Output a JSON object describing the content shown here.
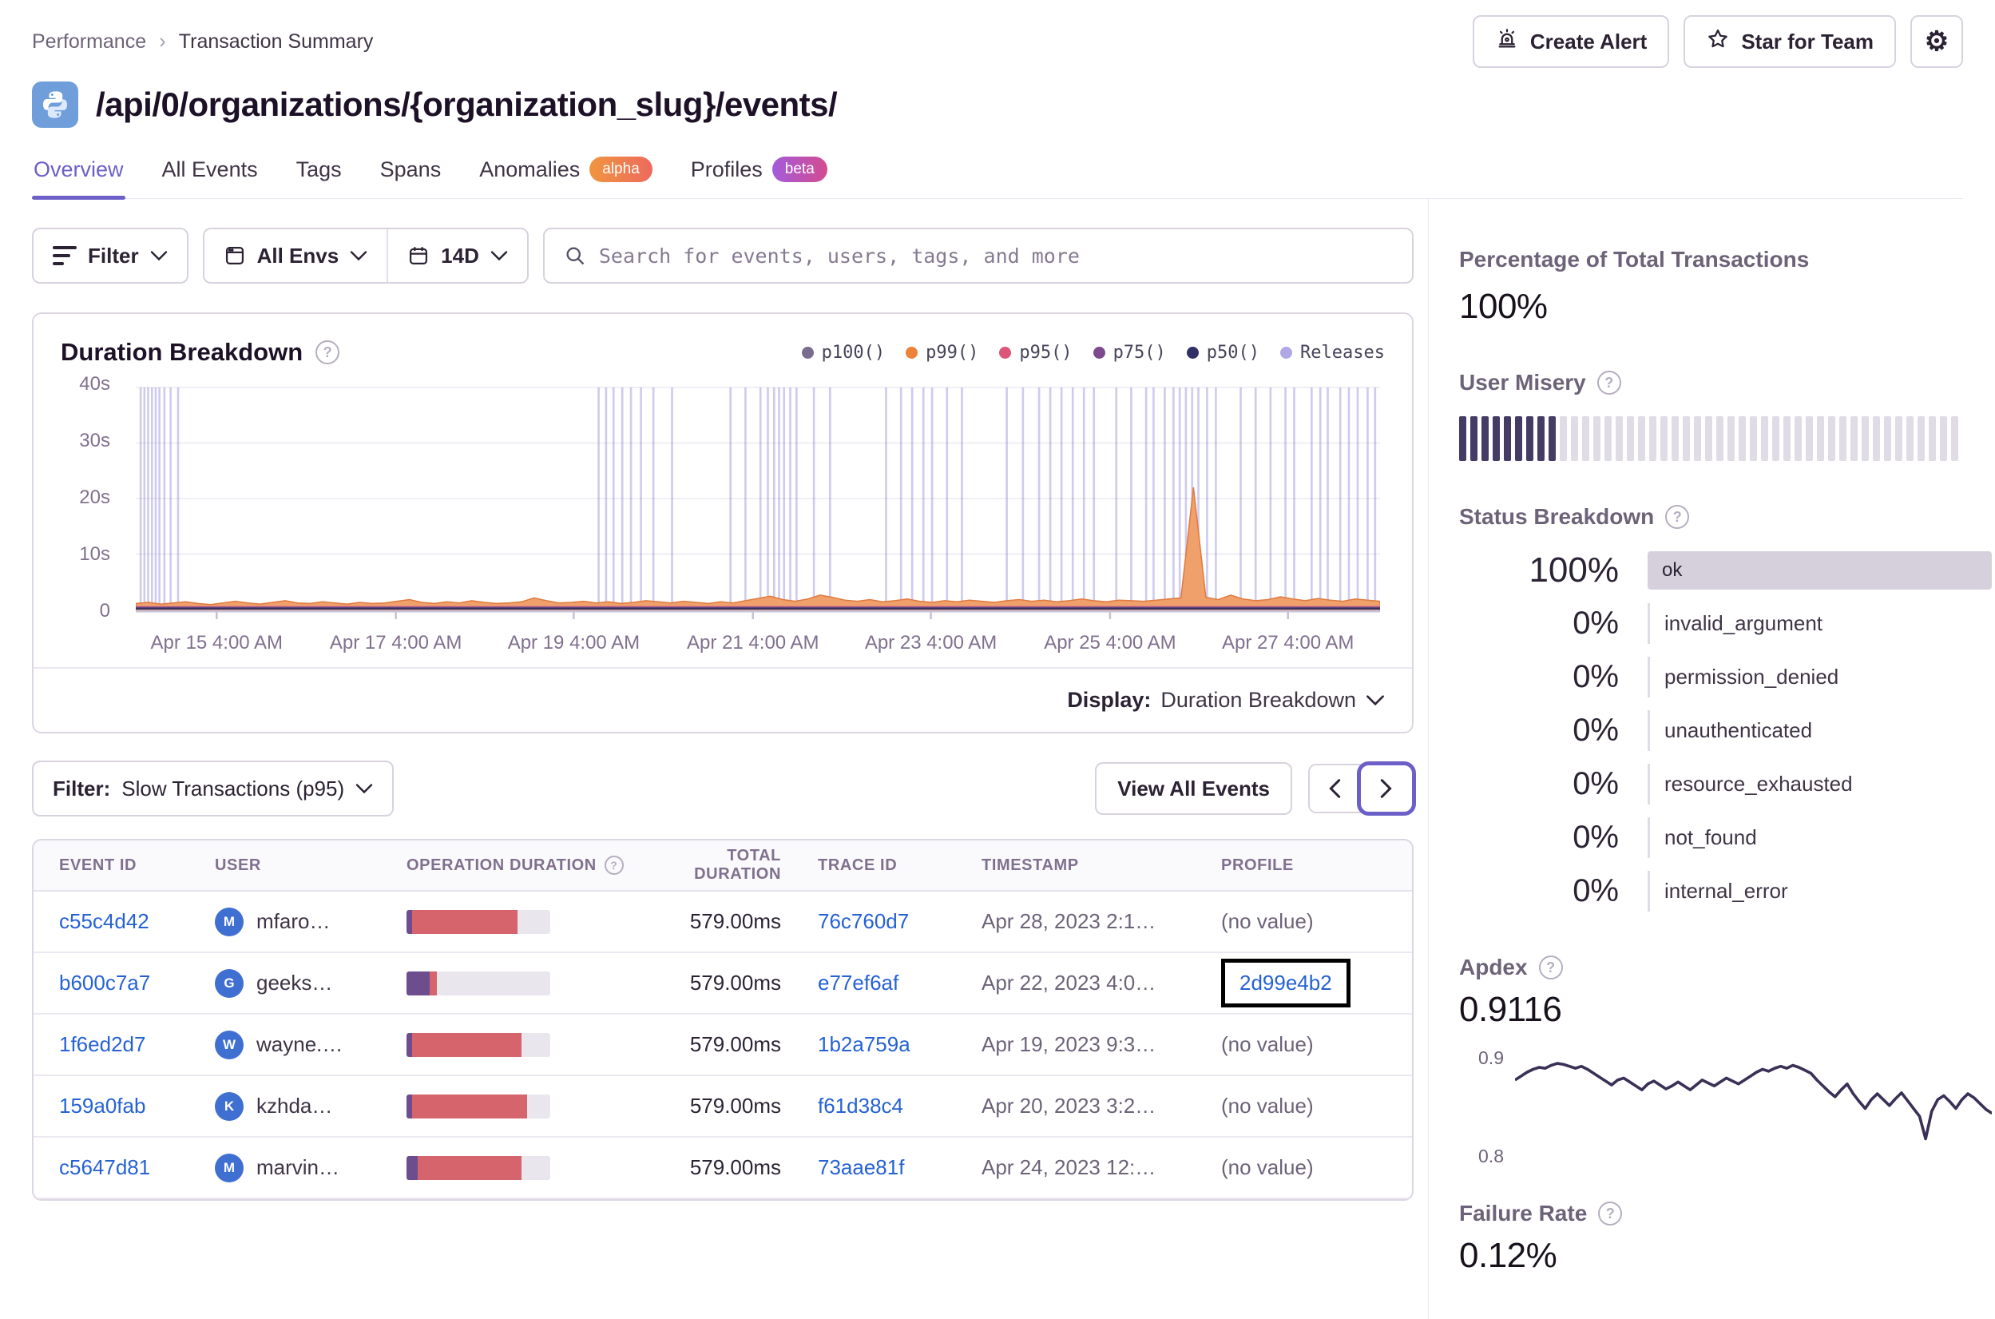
{
  "breadcrumb": {
    "items": [
      "Performance",
      "Transaction Summary"
    ]
  },
  "header": {
    "actions": [
      {
        "label": "Create Alert",
        "icon": "alarm-icon"
      },
      {
        "label": "Star for Team",
        "icon": "star-icon"
      }
    ],
    "settings_icon": "gear-icon"
  },
  "title": {
    "icon": "python-icon",
    "text": "/api/0/organizations/{organization_slug}/events/"
  },
  "tabs": [
    {
      "label": "Overview",
      "active": true
    },
    {
      "label": "All Events"
    },
    {
      "label": "Tags"
    },
    {
      "label": "Spans"
    },
    {
      "label": "Anomalies",
      "badge": "alpha",
      "badge_color": "orange"
    },
    {
      "label": "Profiles",
      "badge": "beta",
      "badge_color": "purple"
    }
  ],
  "filter_bar": {
    "filter_label": "Filter",
    "envs_label": "All Envs",
    "date_label": "14D",
    "search_placeholder": "Search for events, users, tags, and more"
  },
  "duration_card": {
    "title": "Duration Breakdown",
    "legend": [
      {
        "label": "p100()",
        "color": "#7A6C8F"
      },
      {
        "label": "p99()",
        "color": "#ED8239"
      },
      {
        "label": "p95()",
        "color": "#DD5678"
      },
      {
        "label": "p75()",
        "color": "#7D4A8D"
      },
      {
        "label": "p50()",
        "color": "#2F3066"
      },
      {
        "label": "Releases",
        "color": "#B0A7E6"
      }
    ],
    "display_label": "Display:",
    "display_value": "Duration Breakdown"
  },
  "chart_data": [
    {
      "id": "duration_breakdown",
      "type": "area",
      "title": "Duration Breakdown",
      "ylim": [
        0,
        40
      ],
      "y_ticks": [
        {
          "label": "40s",
          "v": 40
        },
        {
          "label": "30s",
          "v": 30
        },
        {
          "label": "20s",
          "v": 20
        },
        {
          "label": "10s",
          "v": 10
        },
        {
          "label": "0",
          "v": 0
        }
      ],
      "x_ticks": [
        {
          "label": "Apr 15 4:00 AM",
          "f": 0.065
        },
        {
          "label": "Apr 17 4:00 AM",
          "f": 0.209
        },
        {
          "label": "Apr 19 4:00 AM",
          "f": 0.352
        },
        {
          "label": "Apr 21 4:00 AM",
          "f": 0.496
        },
        {
          "label": "Apr 23 4:00 AM",
          "f": 0.639
        },
        {
          "label": "Apr 25 4:00 AM",
          "f": 0.783
        },
        {
          "label": "Apr 27 4:00 AM",
          "f": 0.926
        }
      ],
      "series": [
        {
          "name": "p99()",
          "color": "#EFA06B",
          "values": [
            1.1,
            1.3,
            1.0,
            1.2,
            1.4,
            1.1,
            0.9,
            1.2,
            1.5,
            1.2,
            1.0,
            1.3,
            1.6,
            1.2,
            1.1,
            1.4,
            1.2,
            1.0,
            1.3,
            1.1,
            1.2,
            1.5,
            1.8,
            1.3,
            1.1,
            1.4,
            1.2,
            1.6,
            1.3,
            1.1,
            1.2,
            1.4,
            2.1,
            1.6,
            1.2,
            1.3,
            1.5,
            1.2,
            1.4,
            1.1,
            1.3,
            1.6,
            1.4,
            1.2,
            1.5,
            1.3,
            1.1,
            1.4,
            1.2,
            1.6,
            2.0,
            2.4,
            1.8,
            1.5,
            1.9,
            2.6,
            2.2,
            1.7,
            1.5,
            1.8,
            1.4,
            1.6,
            1.9,
            1.5,
            1.3,
            1.6,
            1.4,
            1.7,
            1.5,
            1.3,
            1.6,
            1.8,
            1.5,
            1.7,
            1.4,
            1.6,
            1.9,
            1.6,
            1.4,
            1.7,
            1.6,
            1.5,
            1.7,
            1.9,
            2.1,
            22.0,
            2.2,
            1.8,
            2.6,
            1.9,
            1.6,
            1.8,
            2.3,
            1.9,
            1.6,
            2.0,
            1.7,
            1.5,
            1.9,
            1.7,
            1.5
          ]
        },
        {
          "name": "p95()",
          "color": "#D4618C",
          "approx_constant": 0.62
        },
        {
          "name": "p75()",
          "color": "#6E4D8E",
          "approx_constant": 0.5
        },
        {
          "name": "p50()",
          "color": "#3B3264",
          "approx_constant": 0.34
        }
      ],
      "releases_x": [
        0.004,
        0.007,
        0.01,
        0.013,
        0.016,
        0.019,
        0.023,
        0.028,
        0.034,
        0.372,
        0.378,
        0.384,
        0.391,
        0.398,
        0.406,
        0.416,
        0.431,
        0.478,
        0.49,
        0.502,
        0.508,
        0.513,
        0.517,
        0.521,
        0.526,
        0.531,
        0.545,
        0.558,
        0.603,
        0.615,
        0.624,
        0.633,
        0.64,
        0.652,
        0.664,
        0.7,
        0.713,
        0.726,
        0.735,
        0.744,
        0.753,
        0.762,
        0.77,
        0.788,
        0.8,
        0.812,
        0.818,
        0.827,
        0.834,
        0.839,
        0.844,
        0.849,
        0.854,
        0.861,
        0.868,
        0.888,
        0.9,
        0.912,
        0.924,
        0.931,
        0.945,
        0.952,
        0.958,
        0.968,
        0.975,
        0.982,
        0.99,
        0.996
      ],
      "legend_position": "top-right",
      "grid": true
    },
    {
      "id": "apdex_trend",
      "type": "line",
      "ylim": [
        0.8,
        0.9
      ],
      "y_ticks": [
        "0.9",
        "0.8"
      ],
      "color": "#3B3157",
      "values": [
        0.872,
        0.876,
        0.88,
        0.883,
        0.885,
        0.884,
        0.887,
        0.889,
        0.888,
        0.886,
        0.884,
        0.886,
        0.883,
        0.879,
        0.875,
        0.871,
        0.867,
        0.872,
        0.874,
        0.87,
        0.866,
        0.862,
        0.868,
        0.871,
        0.867,
        0.863,
        0.866,
        0.87,
        0.866,
        0.862,
        0.867,
        0.872,
        0.869,
        0.866,
        0.87,
        0.874,
        0.871,
        0.868,
        0.872,
        0.876,
        0.88,
        0.883,
        0.881,
        0.884,
        0.886,
        0.884,
        0.887,
        0.885,
        0.882,
        0.879,
        0.872,
        0.866,
        0.86,
        0.855,
        0.862,
        0.868,
        0.858,
        0.85,
        0.843,
        0.852,
        0.858,
        0.852,
        0.846,
        0.853,
        0.859,
        0.851,
        0.843,
        0.835,
        0.812,
        0.84,
        0.852,
        0.856,
        0.85,
        0.843,
        0.852,
        0.858,
        0.854,
        0.848,
        0.842,
        0.838
      ]
    },
    {
      "id": "user_misery",
      "type": "bar",
      "total_ticks": 45,
      "filled_ticks": 9,
      "filled_color": "#453C66",
      "empty_color": "#E0DCE5"
    }
  ],
  "events_section": {
    "filter_label": "Filter:",
    "filter_value": "Slow Transactions (p95)",
    "view_all_label": "View All Events"
  },
  "table": {
    "columns": [
      "Event ID",
      "User",
      "Operation Duration",
      "Total Duration",
      "Trace ID",
      "Timestamp",
      "Profile"
    ],
    "rows": [
      {
        "event_id": "c55c4d42",
        "avatar": "M",
        "user": "mfaro…",
        "op_purple": 4,
        "op_red": 73,
        "total": "579.00ms",
        "trace": "76c760d7",
        "timestamp": "Apr 28, 2023 2:1…",
        "profile": "(no value)"
      },
      {
        "event_id": "b600c7a7",
        "avatar": "G",
        "user": "geeks…",
        "op_purple": 16,
        "op_red": 5,
        "total": "579.00ms",
        "trace": "e77ef6af",
        "timestamp": "Apr 22, 2023 4:0…",
        "profile": "2d99e4b2",
        "profile_link": true,
        "profile_highlight": true
      },
      {
        "event_id": "1f6ed2d7",
        "avatar": "W",
        "user": "wayne.…",
        "op_purple": 4,
        "op_red": 76,
        "total": "579.00ms",
        "trace": "1b2a759a",
        "timestamp": "Apr 19, 2023 9:3…",
        "profile": "(no value)"
      },
      {
        "event_id": "159a0fab",
        "avatar": "K",
        "user": "kzhda…",
        "op_purple": 4,
        "op_red": 80,
        "total": "579.00ms",
        "trace": "f61d38c4",
        "timestamp": "Apr 20, 2023 3:2…",
        "profile": "(no value)"
      },
      {
        "event_id": "c5647d81",
        "avatar": "M",
        "user": "marvin…",
        "op_purple": 8,
        "op_red": 72,
        "total": "579.00ms",
        "trace": "73aae81f",
        "timestamp": "Apr 24, 2023 12:…",
        "profile": "(no value)"
      }
    ]
  },
  "sidebar": {
    "pct_total": {
      "title": "Percentage of Total Transactions",
      "value": "100%"
    },
    "user_misery": {
      "title": "User Misery"
    },
    "status_breakdown": {
      "title": "Status Breakdown",
      "statuses": [
        {
          "pct": "100%",
          "label": "ok",
          "bar": true
        },
        {
          "pct": "0%",
          "label": "invalid_argument"
        },
        {
          "pct": "0%",
          "label": "permission_denied"
        },
        {
          "pct": "0%",
          "label": "unauthenticated"
        },
        {
          "pct": "0%",
          "label": "resource_exhausted"
        },
        {
          "pct": "0%",
          "label": "not_found"
        },
        {
          "pct": "0%",
          "label": "internal_error"
        }
      ]
    },
    "apdex": {
      "title": "Apdex",
      "value": "0.9116"
    },
    "failure_rate": {
      "title": "Failure Rate",
      "value": "0.12%"
    }
  }
}
